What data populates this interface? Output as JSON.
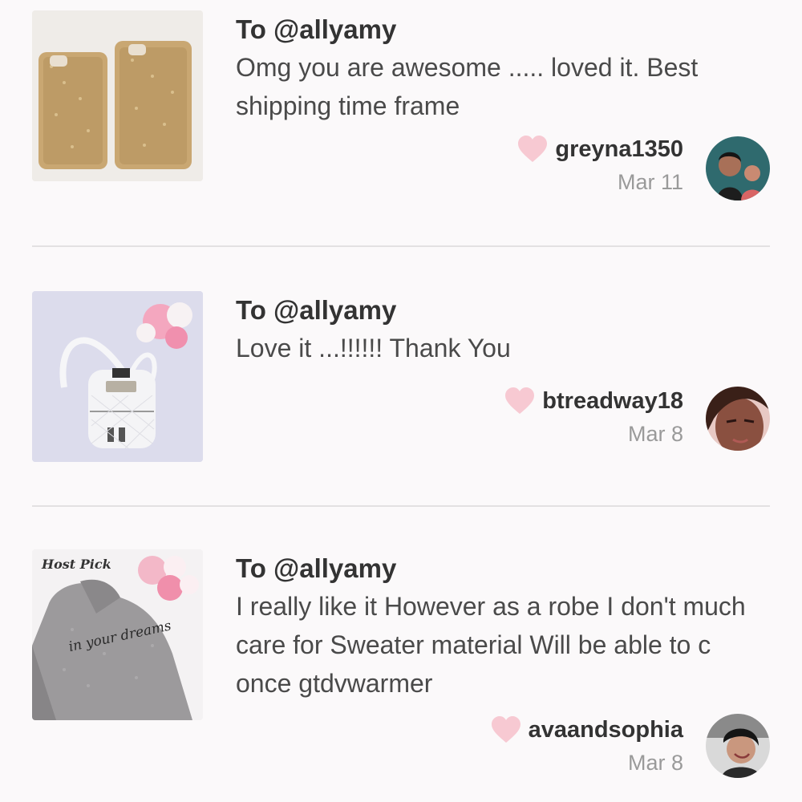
{
  "reviews": [
    {
      "to": "To @allyamy",
      "comment": "Omg you are awesome ..... loved it. Best shipping time frame",
      "username": "greyna1350",
      "date": "Mar 11",
      "thumb_icon": "gold-phone-cases",
      "avatar_icon": "user-avatar"
    },
    {
      "to": "To @allyamy",
      "comment": "Love it ...!!!!!! Thank You",
      "username": "btreadway18",
      "date": "Mar 8",
      "thumb_icon": "white-backpack",
      "avatar_icon": "user-avatar"
    },
    {
      "to": "To @allyamy",
      "comment": "I really like it However as a robe I don't much care for Sweater material Will be able to c once gtdvwarmer",
      "username": "avaandsophia",
      "date": "Mar 8",
      "thumb_icon": "grey-sweater",
      "avatar_icon": "user-avatar",
      "thumb_caption": "Host Pick",
      "thumb_script": "in your dreams"
    }
  ],
  "colors": {
    "heart": "#f7c9d2",
    "divider": "#e3e1e2",
    "date": "#9a9a9a",
    "background": "#fbf9fa"
  }
}
